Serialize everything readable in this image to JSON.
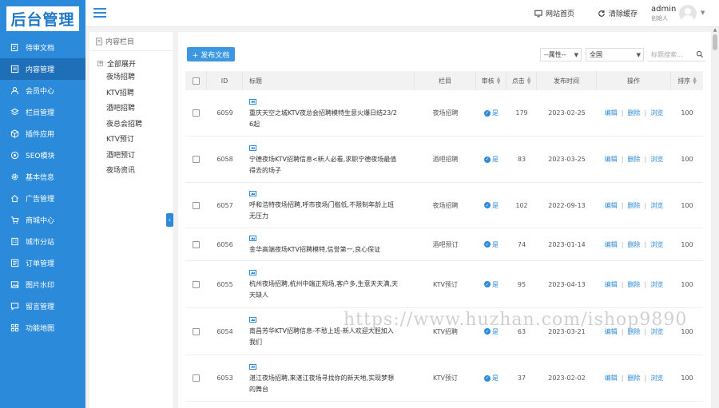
{
  "logo": "后台管理",
  "sidebar": {
    "items": [
      {
        "label": "待审文档",
        "icon": "edit-doc-icon"
      },
      {
        "label": "内容管理",
        "icon": "content-icon",
        "active": true
      },
      {
        "label": "会员中心",
        "icon": "user-icon"
      },
      {
        "label": "栏目管理",
        "icon": "layers-icon"
      },
      {
        "label": "插件应用",
        "icon": "cube-icon"
      },
      {
        "label": "SEO模块",
        "icon": "seo-icon"
      },
      {
        "label": "基本信息",
        "icon": "gear-icon"
      },
      {
        "label": "广告管理",
        "icon": "house-icon"
      },
      {
        "label": "商城中心",
        "icon": "cart-icon"
      },
      {
        "label": "城市分站",
        "icon": "building-icon"
      },
      {
        "label": "订单管理",
        "icon": "order-icon"
      },
      {
        "label": "图片水印",
        "icon": "image-icon"
      },
      {
        "label": "留言管理",
        "icon": "message-icon"
      },
      {
        "label": "功能地图",
        "icon": "grid-icon"
      }
    ]
  },
  "header": {
    "site_home": "网站首页",
    "clear_cache": "清除缓存",
    "user_name": "admin",
    "user_role": "创始人"
  },
  "tree": {
    "title": "内容栏目",
    "expand_all": "全部展开",
    "items": [
      "夜场招聘",
      "KTV招聘",
      "酒吧招聘",
      "夜总会招聘",
      "KTV预订",
      "酒吧预订",
      "夜场资讯"
    ]
  },
  "toolbar": {
    "publish": "+ 发布文档",
    "attr_select": "--属性--",
    "scope_select": "全国",
    "search_placeholder": "标题搜索..."
  },
  "table": {
    "headers": {
      "id": "ID",
      "title": "标题",
      "column": "栏目",
      "audit": "审核",
      "clicks": "点击",
      "time": "发布时间",
      "ops": "操作",
      "sort": "排序"
    },
    "op_labels": {
      "edit": "编辑",
      "delete": "删除",
      "view": "浏览"
    },
    "audit_yes": "是",
    "rows": [
      {
        "id": "6059",
        "title_lines": [
          "重庆天空之城KTV夜总会招聘模特生意火爆日结23/2",
          "6起"
        ],
        "column": "夜场招聘",
        "clicks": "179",
        "time": "2023-02-25",
        "sort": "100"
      },
      {
        "id": "6058",
        "title_lines": [
          "宁德夜场KTV招聘信息<新人必看,求职宁德夜场最值",
          "得去的场子"
        ],
        "column": "酒吧招聘",
        "clicks": "83",
        "time": "2023-03-25",
        "sort": "100"
      },
      {
        "id": "6057",
        "title_lines": [
          "呼和浩特夜场招聘,呼市夜场门槛低,不限制年龄上班",
          "无压力"
        ],
        "column": "夜场招聘",
        "clicks": "102",
        "time": "2022-09-13",
        "sort": "100"
      },
      {
        "id": "6056",
        "title_lines": [
          "金华高端夜场KTV招聘模特,信誉第一,良心保证"
        ],
        "column": "酒吧预订",
        "clicks": "74",
        "time": "2023-01-14",
        "sort": "100"
      },
      {
        "id": "6055",
        "title_lines": [
          "杭州夜场招聘,杭州中端正规场,客户多,生意天天满,天",
          "天缺人"
        ],
        "column": "KTV预订",
        "clicks": "95",
        "time": "2023-04-13",
        "sort": "100"
      },
      {
        "id": "6054",
        "title_lines": [
          "南昌芳华KTV招聘信息-不愁上班-新人欢迎大胆加入",
          "我们"
        ],
        "column": "KTV招聘",
        "clicks": "63",
        "time": "2023-03-21",
        "sort": "100"
      },
      {
        "id": "6053",
        "title_lines": [
          "湛江夜场招聘,来湛江夜场寻找你的新天地,实现梦想",
          "的舞台"
        ],
        "column": "KTV预订",
        "clicks": "37",
        "time": "2023-02-02",
        "sort": "100"
      }
    ]
  },
  "watermark": "https://www.huzhan.com/ishop9890",
  "colors": {
    "sidebar": "#2b8ad9",
    "accent": "#2b8ad9"
  }
}
